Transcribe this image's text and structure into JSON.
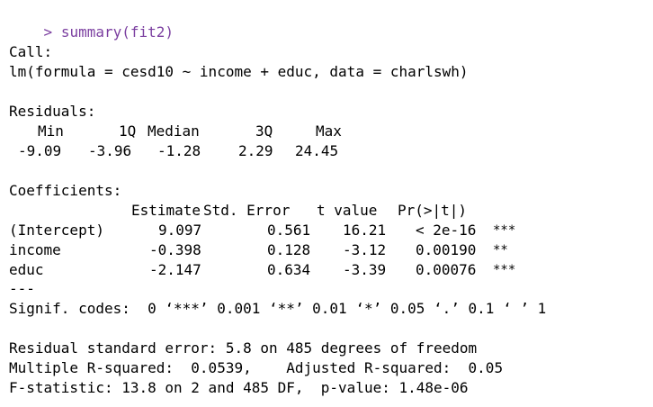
{
  "console": {
    "prompt": ">",
    "command": "summary(fit2)",
    "colors": {
      "prompt": "#7b3fa0",
      "output": "#000000",
      "background": "#ffffff"
    },
    "call": {
      "header": "Call:",
      "formula": "lm(formula = cesd10 ~ income + educ, data = charlswh)"
    },
    "residuals": {
      "header": "Residuals:",
      "labels": [
        "Min",
        "1Q",
        "Median",
        "3Q",
        "Max"
      ],
      "values": [
        "-9.09",
        "-3.96",
        "-1.28",
        "2.29",
        "24.45"
      ]
    },
    "coefficients": {
      "header": "Coefficients:",
      "columns": [
        "Estimate",
        "Std. Error",
        "t value",
        "Pr(>|t|)"
      ],
      "rows": [
        {
          "term": "(Intercept)",
          "estimate": "9.097",
          "std_error": "0.561",
          "t_value": "16.21",
          "p_value": "< 2e-16",
          "stars": "***"
        },
        {
          "term": "income",
          "estimate": "-0.398",
          "std_error": "0.128",
          "t_value": "-3.12",
          "p_value": "0.00190",
          "stars": "**"
        },
        {
          "term": "educ",
          "estimate": "-2.147",
          "std_error": "0.634",
          "t_value": "-3.39",
          "p_value": "0.00076",
          "stars": "***"
        }
      ],
      "separator": "---",
      "signif_codes": "Signif. codes:  0 ‘***’ 0.001 ‘**’ 0.01 ‘*’ 0.05 ‘.’ 0.1 ‘ ’ 1"
    },
    "fit_stats": [
      "Residual standard error: 5.8 on 485 degrees of freedom",
      "Multiple R-squared:  0.0539,    Adjusted R-squared:  0.05",
      "F-statistic: 13.8 on 2 and 485 DF,  p-value: 1.48e-06"
    ]
  }
}
